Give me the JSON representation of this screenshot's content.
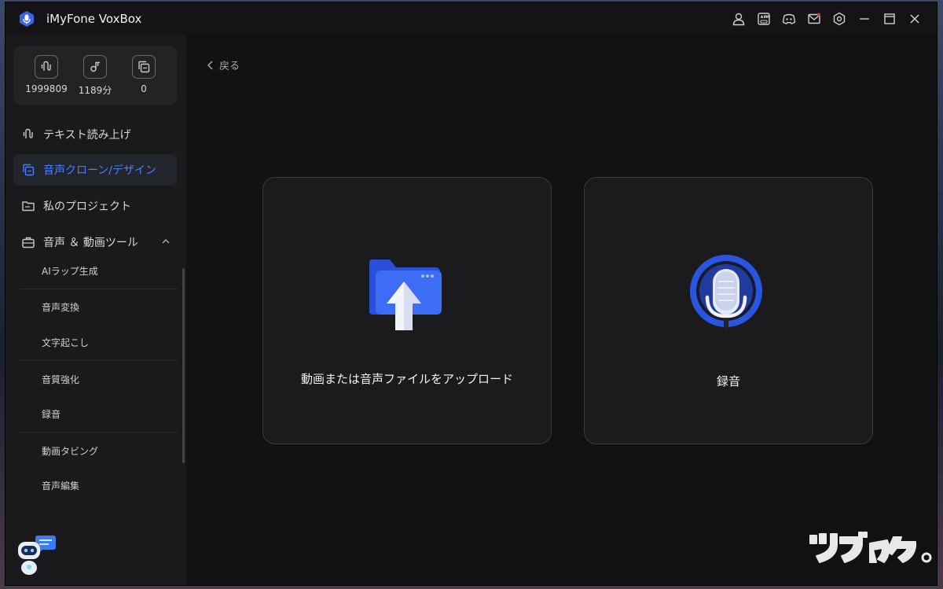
{
  "window": {
    "title": "iMyFone VoxBox"
  },
  "titlebar": {
    "icons": [
      "user-icon",
      "app-icon",
      "discord-icon",
      "mail-icon",
      "settings-icon",
      "minimize-icon",
      "maximize-icon",
      "close-icon"
    ]
  },
  "stats": [
    {
      "icon": "tts-icon",
      "value": "1999809"
    },
    {
      "icon": "audio-icon",
      "value": "1189分"
    },
    {
      "icon": "clone-icon",
      "value": "0"
    }
  ],
  "sidebar": {
    "items": [
      {
        "label": "テキスト読み上げ",
        "icon": "tts-icon",
        "active": false
      },
      {
        "label": "音声クローン/デザイン",
        "icon": "clone-icon",
        "active": true
      },
      {
        "label": "私のプロジェクト",
        "icon": "folder-icon",
        "active": false
      },
      {
        "label": "音声 ＆ 動画ツール",
        "icon": "toolbox-icon",
        "active": false,
        "expanded": true
      }
    ],
    "sub_items": [
      "AIラップ生成",
      "音声変換",
      "文字起こし",
      "音質強化",
      "録音",
      "動画タビング",
      "音声編集"
    ]
  },
  "main": {
    "back_label": "戻る",
    "cards": [
      {
        "label": "動画または音声ファイルをアップロード",
        "icon": "upload-folder-icon"
      },
      {
        "label": "録音",
        "icon": "microphone-icon"
      }
    ]
  },
  "watermark": "ツブヤク。",
  "colors": {
    "accent": "#4a7dff",
    "bg": "#121214",
    "sidebar": "#1a1a1c",
    "card": "#1b1b1e"
  }
}
